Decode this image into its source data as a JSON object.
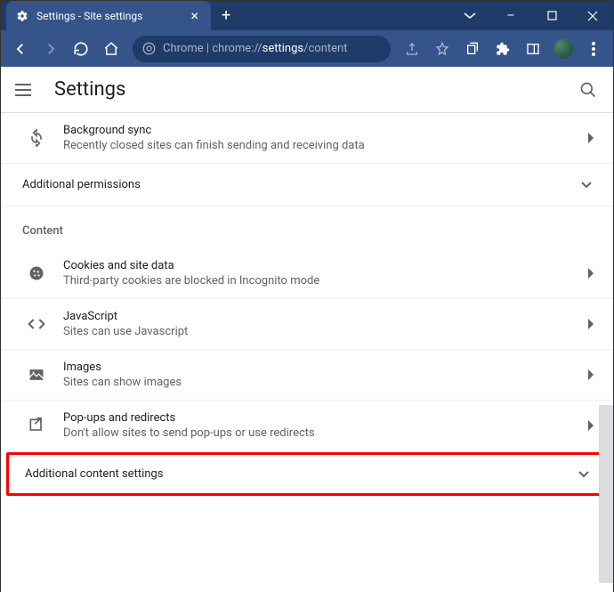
{
  "window": {
    "tab_title": "Settings - Site settings",
    "minimize": "–",
    "maximize": "▢",
    "close": "×"
  },
  "omnibox": {
    "prefix": "Chrome  |  chrome://",
    "bold": "settings",
    "suffix": "/content"
  },
  "header": {
    "title": "Settings"
  },
  "rows": {
    "bg_sync": {
      "title": "Background sync",
      "sub": "Recently closed sites can finish sending and receiving data"
    },
    "add_perm": {
      "label": "Additional permissions"
    },
    "content_header": "Content",
    "cookies": {
      "title": "Cookies and site data",
      "sub": "Third-party cookies are blocked in Incognito mode"
    },
    "js": {
      "title": "JavaScript",
      "sub": "Sites can use Javascript"
    },
    "images": {
      "title": "Images",
      "sub": "Sites can show images"
    },
    "popups": {
      "title": "Pop-ups and redirects",
      "sub": "Don't allow sites to send pop-ups or use redirects"
    },
    "add_content": {
      "label": "Additional content settings"
    }
  }
}
